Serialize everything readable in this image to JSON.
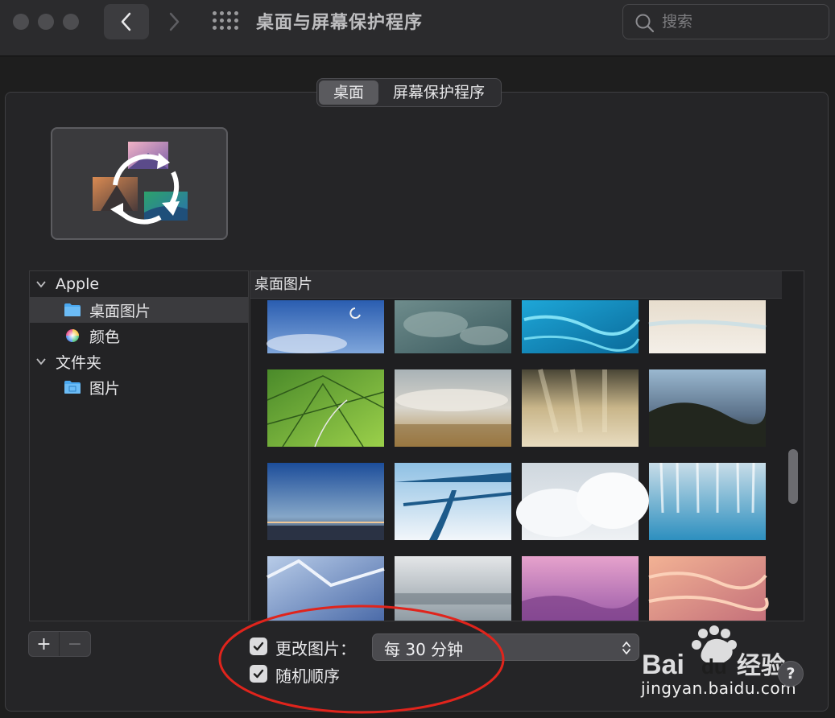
{
  "window": {
    "title": "桌面与屏幕保护程序",
    "search_placeholder": "搜索"
  },
  "tabs": [
    {
      "label": "桌面",
      "active": true
    },
    {
      "label": "屏幕保护程序",
      "active": false
    }
  ],
  "sidebar": {
    "sections": [
      {
        "label": "Apple",
        "items": [
          {
            "label": "桌面图片",
            "icon": "folder-icon",
            "selected": true
          },
          {
            "label": "颜色",
            "icon": "color-wheel-icon",
            "selected": false
          }
        ]
      },
      {
        "label": "文件夹",
        "items": [
          {
            "label": "图片",
            "icon": "pictures-folder-icon",
            "selected": false
          }
        ]
      }
    ],
    "add_label": "+",
    "remove_label": "−"
  },
  "gallery": {
    "header": "桌面图片"
  },
  "options": {
    "change_picture_label": "更改图片：",
    "change_picture_checked": true,
    "interval_value": "每 30 分钟",
    "random_order_label": "随机顺序",
    "random_order_checked": true
  },
  "help_label": "?",
  "watermark": {
    "text": "jingyan.baidu.com",
    "logo_text": "Baidu经验"
  },
  "colors": {
    "accent_folder": "#4aa8f0",
    "annotation_circle": "#e0241c"
  }
}
